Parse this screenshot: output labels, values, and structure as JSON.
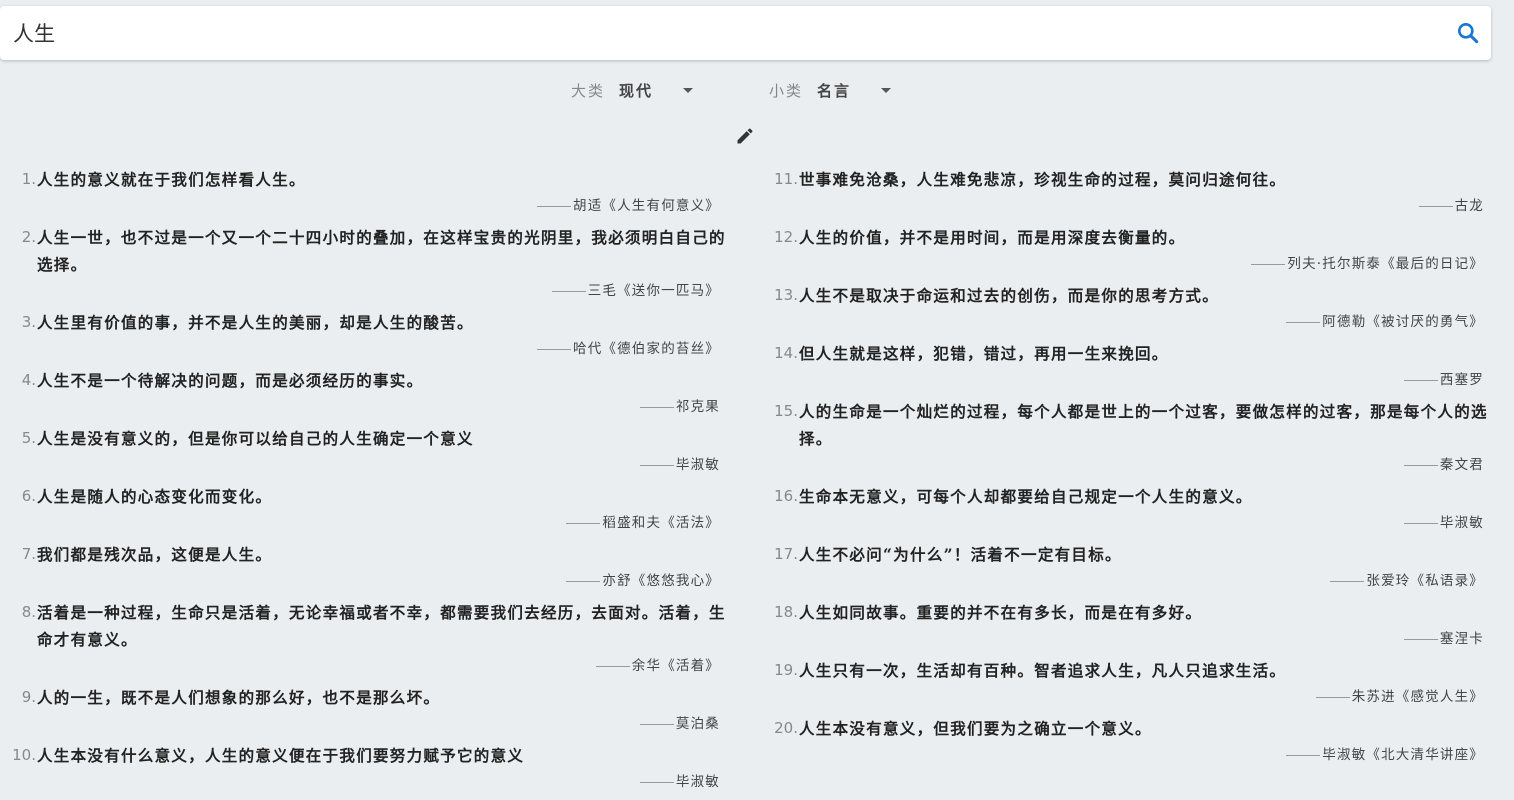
{
  "search": {
    "value": "人生",
    "icon": "search-icon"
  },
  "filters": {
    "category": {
      "label": "大类",
      "value": "现代"
    },
    "subcategory": {
      "label": "小类",
      "value": "名言"
    }
  },
  "edit_icon": "pencil-icon",
  "accent_color": "#1976d2",
  "quotes_left": [
    {
      "num": "1.",
      "text": "人生的意义就在于我们怎样看人生。",
      "author": "胡适《人生有何意义》"
    },
    {
      "num": "2.",
      "text": "人生一世，也不过是一个又一个二十四小时的叠加，在这样宝贵的光阴里，我必须明白自己的选择。",
      "author": "三毛《送你一匹马》"
    },
    {
      "num": "3.",
      "text": "人生里有价值的事，并不是人生的美丽，却是人生的酸苦。",
      "author": "哈代《德伯家的苔丝》"
    },
    {
      "num": "4.",
      "text": "人生不是一个待解决的问题，而是必须经历的事实。",
      "author": "祁克果"
    },
    {
      "num": "5.",
      "text": "人生是没有意义的，但是你可以给自己的人生确定一个意义",
      "author": "毕淑敏"
    },
    {
      "num": "6.",
      "text": "人生是随人的心态变化而变化。",
      "author": "稻盛和夫《活法》"
    },
    {
      "num": "7.",
      "text": "我们都是残次品，这便是人生。",
      "author": "亦舒《悠悠我心》"
    },
    {
      "num": "8.",
      "text": "活着是一种过程，生命只是活着，无论幸福或者不幸，都需要我们去经历，去面对。活着，生命才有意义。",
      "author": "余华《活着》"
    },
    {
      "num": "9.",
      "text": "人的一生，既不是人们想象的那么好，也不是那么坏。",
      "author": "莫泊桑"
    },
    {
      "num": "10.",
      "text": "人生本没有什么意义，人生的意义便在于我们要努力赋予它的意义",
      "author": "毕淑敏"
    }
  ],
  "quotes_right": [
    {
      "num": "11.",
      "text": "世事难免沧桑，人生难免悲凉，珍视生命的过程，莫问归途何往。",
      "author": "古龙"
    },
    {
      "num": "12.",
      "text": "人生的价值，并不是用时间，而是用深度去衡量的。",
      "author": "列夫·托尔斯泰《最后的日记》"
    },
    {
      "num": "13.",
      "text": "人生不是取决于命运和过去的创伤，而是你的思考方式。",
      "author": "阿德勒《被讨厌的勇气》"
    },
    {
      "num": "14.",
      "text": "但人生就是这样，犯错，错过，再用一生来挽回。",
      "author": "西塞罗"
    },
    {
      "num": "15.",
      "text": "人的生命是一个灿烂的过程，每个人都是世上的一个过客，要做怎样的过客，那是每个人的选择。",
      "author": "秦文君"
    },
    {
      "num": "16.",
      "text": "生命本无意义，可每个人却都要给自己规定一个人生的意义。",
      "author": "毕淑敏"
    },
    {
      "num": "17.",
      "text": "人生不必问“为什么”！活着不一定有目标。",
      "author": "张爱玲《私语录》"
    },
    {
      "num": "18.",
      "text": "人生如同故事。重要的并不在有多长，而是在有多好。",
      "author": "塞涅卡"
    },
    {
      "num": "19.",
      "text": "人生只有一次，生活却有百种。智者追求人生，凡人只追求生活。",
      "author": "朱苏进《感觉人生》"
    },
    {
      "num": "20.",
      "text": "人生本没有意义，但我们要为之确立一个意义。",
      "author": "毕淑敏《北大清华讲座》"
    }
  ]
}
